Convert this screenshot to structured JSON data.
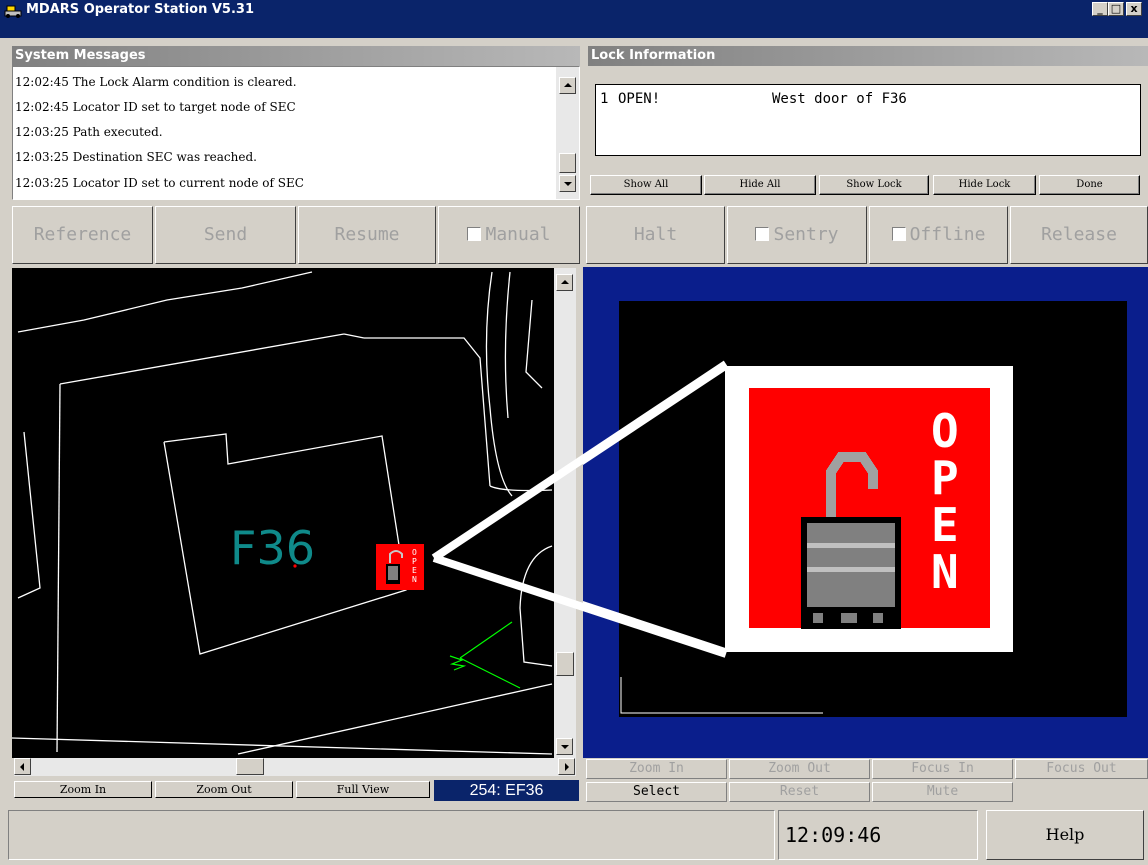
{
  "window": {
    "title": "MDARS Operator Station V5.31",
    "minimize": "_",
    "maximize": "□",
    "close": "x"
  },
  "system_messages": {
    "header": "System Messages",
    "lines": [
      "12:02:45 The Lock Alarm condition is cleared.",
      "12:02:45 Locator ID set to target node of SEC",
      "12:03:25 Path executed.",
      "12:03:25 Destination SEC was reached.",
      "12:03:25 Locator ID set to current node of SEC"
    ]
  },
  "lock_information": {
    "header": "Lock Information",
    "entries": [
      {
        "index": "1",
        "state": "OPEN!",
        "description": "West door of F36"
      }
    ],
    "buttons": [
      "Show All",
      "Hide All",
      "Show Lock",
      "Hide Lock",
      "Done"
    ]
  },
  "controls": {
    "reference": "Reference",
    "send": "Send",
    "resume": "Resume",
    "manual": "Manual",
    "halt": "Halt",
    "sentry": "Sentry",
    "offline": "Offline",
    "release": "Release"
  },
  "map": {
    "building_label": "F36",
    "lock_label": "OPEN",
    "buttons": {
      "zoom_in": "Zoom In",
      "zoom_out": "Zoom Out",
      "full_view": "Full View"
    },
    "status": "254: EF36"
  },
  "camera": {
    "lock_label": "OPEN",
    "row1": [
      "Zoom In",
      "Zoom Out",
      "Focus In",
      "Focus Out"
    ],
    "row2": [
      "Select",
      "Reset",
      "Mute"
    ]
  },
  "statusbar": {
    "message": "",
    "clock": "12:09:46",
    "help": "Help"
  },
  "colors": {
    "titlebar": "#0a246a",
    "map_bg": "#000000",
    "camera_bg": "#0a1e8c",
    "lock_red": "#ff0000",
    "map_text": "#0f8a8a"
  }
}
